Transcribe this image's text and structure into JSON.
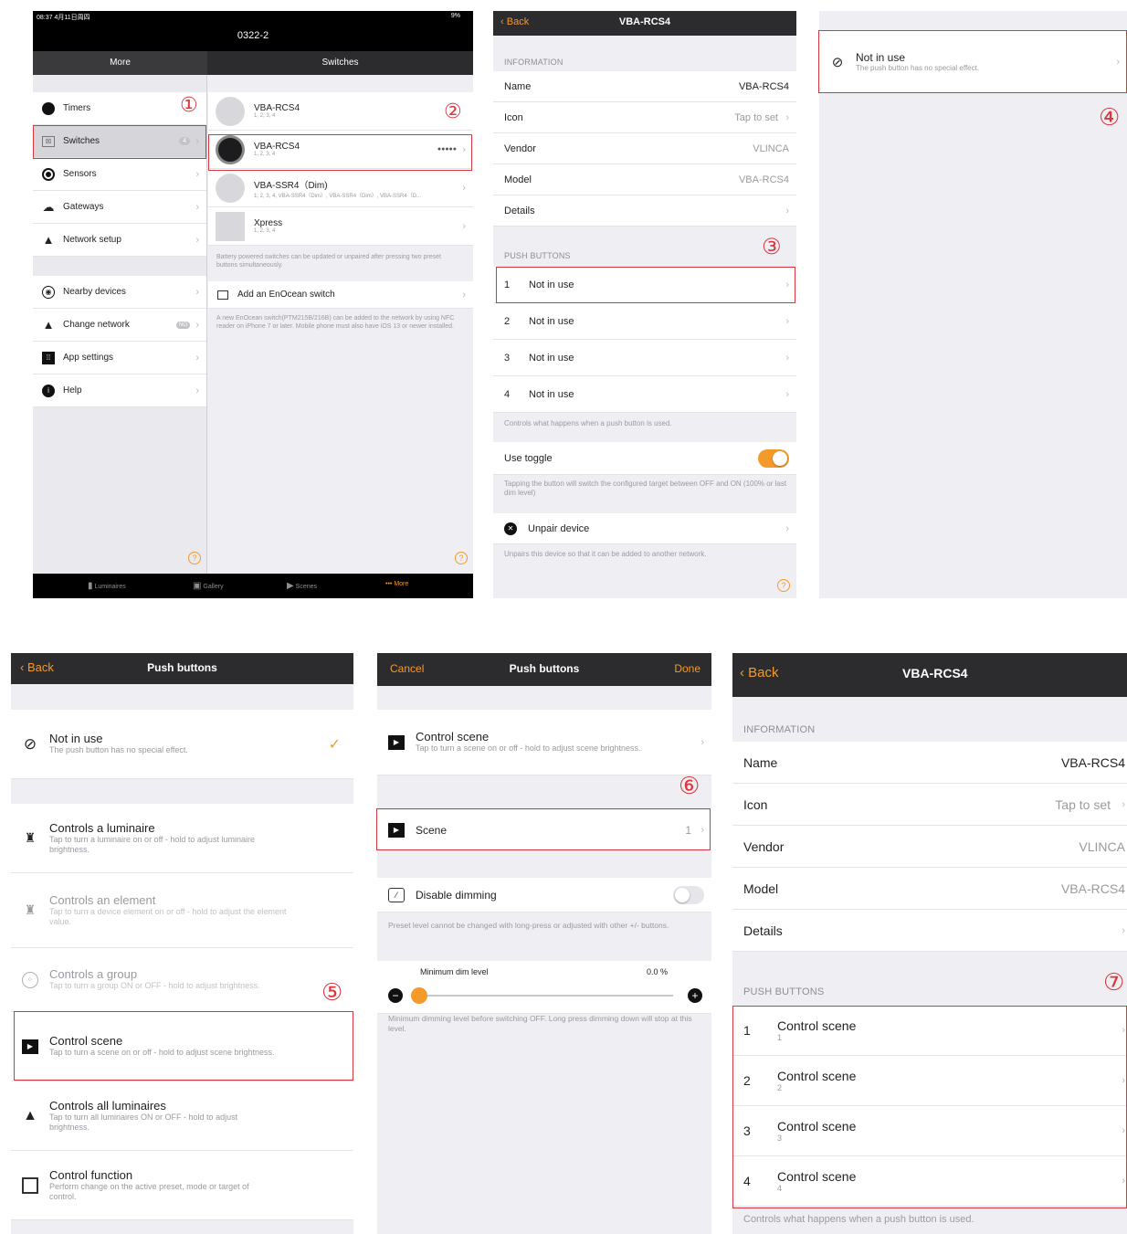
{
  "markers": [
    "①",
    "②",
    "③",
    "④",
    "⑤",
    "⑥",
    "⑦"
  ],
  "p1": {
    "status_time": "08:37  4月11日周四",
    "status_right": "9%",
    "header_title": "0322-2",
    "left_header": "More",
    "right_header": "Switches",
    "menu": [
      {
        "label": "Timers",
        "icon": "clock-icon"
      },
      {
        "label": "Switches",
        "icon": "switch-icon",
        "badge": "4"
      },
      {
        "label": "Sensors",
        "icon": "sensor-icon"
      },
      {
        "label": "Gateways",
        "icon": "gateway-icon"
      },
      {
        "label": "Network setup",
        "icon": "network-icon"
      }
    ],
    "menu2": [
      {
        "label": "Nearby devices",
        "icon": "nearby-icon"
      },
      {
        "label": "Change network",
        "icon": "network-icon",
        "badge": "NO"
      },
      {
        "label": "App settings",
        "icon": "settings-icon"
      },
      {
        "label": "Help",
        "icon": "help-icon"
      }
    ],
    "switches": [
      {
        "name": "VBA-RCS4",
        "sub": "1, 2, 3, 4",
        "dots": ""
      },
      {
        "name": "VBA-RCS4",
        "sub": "1, 2, 3, 4",
        "dots": "●●●●●"
      },
      {
        "name": "VBA-SSR4（Dim)",
        "sub": "1, 2, 3, 4, VBA-SSR4（Dim）, VBA-SSR4（Dim）, VBA-SSR4（D...",
        "dots": ""
      },
      {
        "name": "Xpress",
        "sub": "1, 2, 3, 4",
        "dots": ""
      }
    ],
    "battery_note": "Battery powered switches can be updated or unpaired after pressing two preset buttons simultaneously.",
    "add_label": "Add an EnOcean switch",
    "nfc_note": "A new EnOcean switch(PTM215B/216B) can be added to the network by using NFC reader on iPhone 7 or later. Mobile phone must also have iOS 13 or newer installed.",
    "tabs": [
      {
        "label": "Luminaires",
        "icon": "lamp-icon"
      },
      {
        "label": "Gallery",
        "icon": "gallery-icon"
      },
      {
        "label": "Scenes",
        "icon": "scene-icon"
      },
      {
        "label": "More",
        "icon": "more-icon"
      }
    ]
  },
  "p2": {
    "back": "Back",
    "title": "VBA-RCS4",
    "info_header": "INFORMATION",
    "info": [
      {
        "label": "Name",
        "value": "VBA-RCS4"
      },
      {
        "label": "Icon",
        "value": "Tap to set"
      },
      {
        "label": "Vendor",
        "value": "VLINCA"
      },
      {
        "label": "Model",
        "value": "VBA-RCS4"
      },
      {
        "label": "Details",
        "value": ""
      }
    ],
    "pb_header": "PUSH BUTTONS",
    "buttons": [
      {
        "num": "1",
        "label": "Not in use"
      },
      {
        "num": "2",
        "label": "Not in use"
      },
      {
        "num": "3",
        "label": "Not in use"
      },
      {
        "num": "4",
        "label": "Not in use"
      }
    ],
    "pb_note": "Controls what happens when a push button is used.",
    "toggle_label": "Use toggle",
    "toggle_note": "Tapping the button will switch the configured target between OFF and ON (100% or last dim level)",
    "unpair_label": "Unpair device",
    "unpair_note": "Unpairs this device so that it can be added to another network.",
    "accent": "#f39a2a"
  },
  "p3": {
    "title": "Not in use",
    "sub": "The push button has no special effect."
  },
  "p4": {
    "back": "Back",
    "title": "Push buttons",
    "not_in_use": {
      "title": "Not in use",
      "sub": "The push button has no special effect."
    },
    "options": [
      {
        "title": "Controls a luminaire",
        "sub": "Tap to turn a luminaire on or off - hold to adjust luminaire brightness.",
        "icon": "lamp-icon",
        "enabled": true
      },
      {
        "title": "Controls an element",
        "sub": "Tap to turn a device element on or off - hold to adjust the element value.",
        "icon": "lamp-icon",
        "enabled": false
      },
      {
        "title": "Controls a group",
        "sub": "Tap to turn a group ON or OFF - hold to adjust brightness.",
        "icon": "group-icon",
        "enabled": false
      },
      {
        "title": "Control scene",
        "sub": "Tap to turn a scene on or off - hold to adjust scene brightness.",
        "icon": "scene-icon",
        "enabled": true
      },
      {
        "title": "Controls all luminaires",
        "sub": "Tap to turn all luminaires ON or OFF - hold to adjust brightness.",
        "icon": "network-icon",
        "enabled": true
      },
      {
        "title": "Control function",
        "sub": "Perform change on the active preset, mode or target of control.",
        "icon": "function-icon",
        "enabled": true
      }
    ]
  },
  "p5": {
    "cancel": "Cancel",
    "title": "Push buttons",
    "done": "Done",
    "control_scene": {
      "title": "Control scene",
      "sub": "Tap to turn a scene on or off - hold to adjust scene brightness."
    },
    "scene_label": "Scene",
    "scene_value": "1",
    "disable_label": "Disable dimming",
    "disable_note": "Preset level cannot be changed with long-press or adjusted with other +/- buttons.",
    "min_label": "Minimum dim level",
    "min_value": "0.0 %",
    "min_fraction": 0.0,
    "min_note": "Minimum dimming level before switching OFF. Long press dimming down will stop at this level."
  },
  "p6": {
    "back": "Back",
    "title": "VBA-RCS4",
    "info_header": "INFORMATION",
    "info": [
      {
        "label": "Name",
        "value": "VBA-RCS4"
      },
      {
        "label": "Icon",
        "value": "Tap to set"
      },
      {
        "label": "Vendor",
        "value": "VLINCA"
      },
      {
        "label": "Model",
        "value": "VBA-RCS4"
      },
      {
        "label": "Details",
        "value": ""
      }
    ],
    "pb_header": "PUSH BUTTONS",
    "buttons": [
      {
        "num": "1",
        "label": "Control scene",
        "sub": "1"
      },
      {
        "num": "2",
        "label": "Control scene",
        "sub": "2"
      },
      {
        "num": "3",
        "label": "Control scene",
        "sub": "3"
      },
      {
        "num": "4",
        "label": "Control scene",
        "sub": "4"
      }
    ],
    "pb_note": "Controls what happens when a push button is used."
  }
}
